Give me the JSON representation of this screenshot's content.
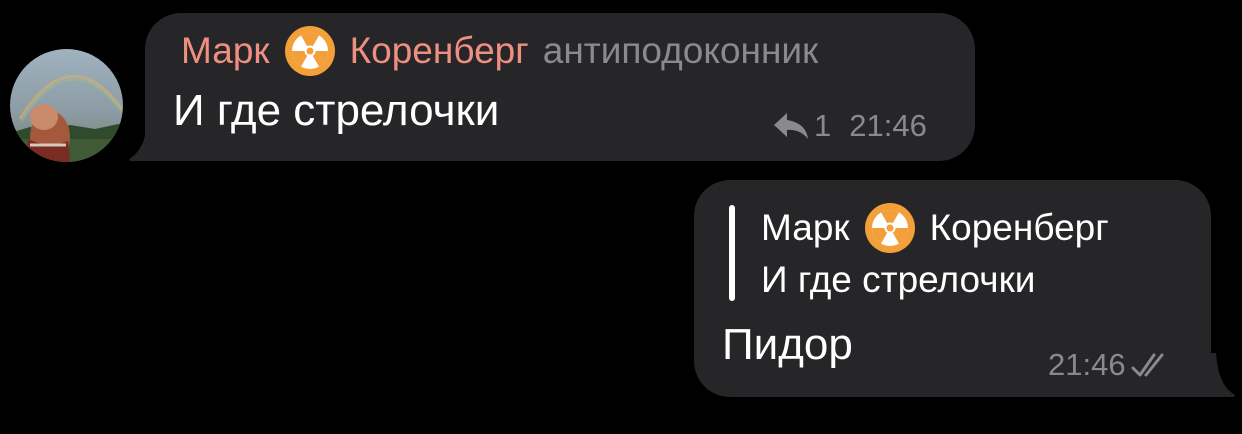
{
  "incoming": {
    "sender_first": "Марк",
    "sender_last": "Коренберг",
    "sender_badge_icon": "radioactive-icon",
    "sender_rank": "антиподоконник",
    "text": "И где стрелочки",
    "reply_count": "1",
    "time": "21:46"
  },
  "outgoing": {
    "quote": {
      "author_first": "Марк",
      "author_last": "Коренберг",
      "author_badge_icon": "radioactive-icon",
      "text": "И где стрелочки"
    },
    "text": "Пидор",
    "time": "21:46",
    "status_icon": "double-check-icon"
  },
  "colors": {
    "background": "#000000",
    "bubble": "#262628",
    "sender_name": "#ef8f82",
    "meta": "#8a8a8e",
    "text": "#ffffff",
    "badge": "#f3a03a"
  }
}
